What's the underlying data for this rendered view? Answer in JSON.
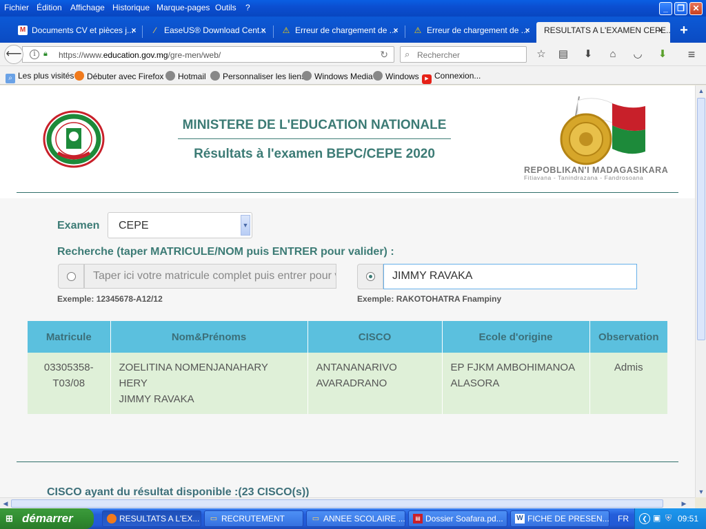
{
  "menu": [
    "Fichier",
    "Édition",
    "Affichage",
    "Historique",
    "Marque-pages",
    "Outils",
    "?"
  ],
  "tabs": [
    {
      "label": "Documents CV et pièces j...",
      "icon": "gmail-icon"
    },
    {
      "label": "EaseUS® Download Cent...",
      "icon": "easeus-icon"
    },
    {
      "label": "Erreur de chargement de ...",
      "icon": "warning-icon"
    },
    {
      "label": "Erreur de chargement de ...",
      "icon": "warning-icon"
    },
    {
      "label": "RESULTATS A L'EXAMEN CEPE...",
      "icon": "none"
    }
  ],
  "nav": {
    "url_host": "https://www.",
    "url_domain": "education.gov.mg",
    "url_path": "/gre-men/web/",
    "search_placeholder": "Rechercher"
  },
  "bookmarks": [
    "Les plus visités",
    "Débuter avec Firefox",
    "Hotmail",
    "Personnaliser les liens",
    "Windows Media",
    "Windows",
    "Connexion..."
  ],
  "header": {
    "ministry": "MINISTERE DE L'EDUCATION NATIONALE",
    "exam": "Résultats à l'examen BEPC/CEPE 2020",
    "flag_caption": "REPOBLIKAN'I MADAGASIKARA",
    "flag_motto": "Fitiavana - Tanindrazana - Fandrosoana"
  },
  "form": {
    "exam_label": "Examen",
    "exam_value": "CEPE",
    "search_label": "Recherche (taper MATRICULE/NOM puis ENTRER pour valider) :",
    "matricule_placeholder": "Taper ici votre matricule complet puis entrer pour v",
    "name_value": "JIMMY RAVAKA",
    "example_matricule": "Exemple: 12345678-A12/12",
    "example_name": "Exemple: RAKOTOHATRA Fnampiny"
  },
  "table": {
    "headers": [
      "Matricule",
      "Nom&Prénoms",
      "CISCO",
      "Ecole d'origine",
      "Observation"
    ],
    "row": {
      "matricule_1": "03305358-",
      "matricule_2": "T03/08",
      "name_1": "ZOELITINA NOMENJANAHARY HERY",
      "name_2": "JIMMY RAVAKA",
      "cisco_1": "ANTANANARIVO",
      "cisco_2": "AVARADRANO",
      "ecole_1": "EP FJKM AMBOHIMANOA",
      "ecole_2": "ALASORA",
      "observation": "Admis"
    }
  },
  "cisco_footer": "CISCO ayant du résultat disponible :(23 CISCO(s))",
  "taskbar": {
    "start": "démarrer",
    "items": [
      {
        "label": "RESULTATS A L'EX...",
        "icon": "firefox-icon",
        "active": true
      },
      {
        "label": "RECRUTEMENT",
        "icon": "folder-icon"
      },
      {
        "label": "ANNEE SCOLAIRE ...",
        "icon": "folder-icon"
      },
      {
        "label": "Dossier Soafara.pd...",
        "icon": "pdf-icon"
      },
      {
        "label": "FICHE DE PRESEN...",
        "icon": "word-icon"
      }
    ],
    "lang": "FR",
    "clock": "09:51"
  }
}
